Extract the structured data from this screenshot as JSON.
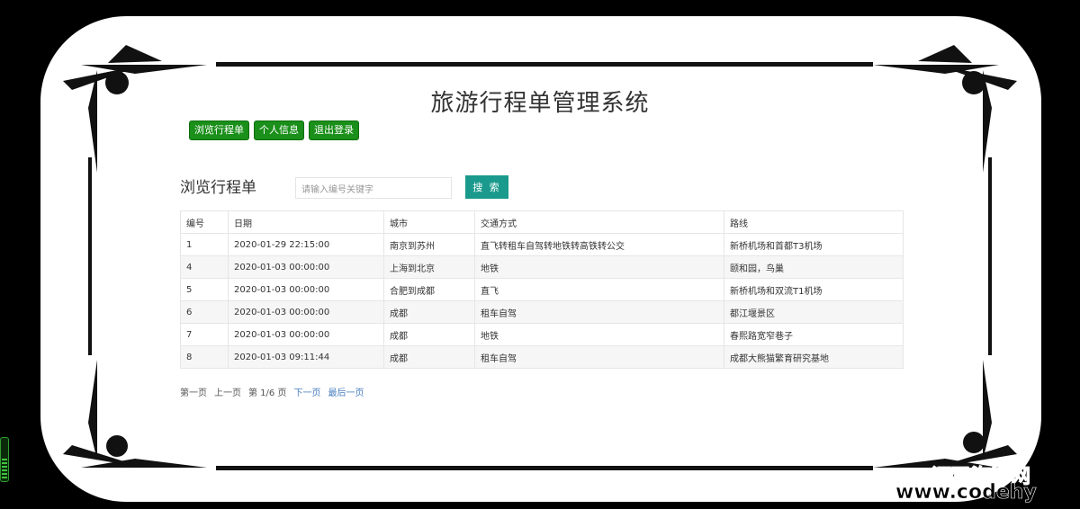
{
  "app": {
    "title": "旅游行程单管理系统"
  },
  "nav": {
    "items": [
      "浏览行程单",
      "个人信息",
      "退出登录"
    ]
  },
  "section": {
    "title": "浏览行程单"
  },
  "search": {
    "placeholder": "请输入编号关键字",
    "button_label": "搜 索"
  },
  "table": {
    "columns": [
      "编号",
      "日期",
      "城市",
      "交通方式",
      "路线"
    ],
    "rows": [
      [
        "1",
        "2020-01-29 22:15:00",
        "南京到苏州",
        "直飞转租车自驾转地铁转高铁转公交",
        "新桥机场和首都T3机场"
      ],
      [
        "4",
        "2020-01-03 00:00:00",
        "上海到北京",
        "地铁",
        "颐和园，鸟巢"
      ],
      [
        "5",
        "2020-01-03 00:00:00",
        "合肥到成都",
        "直飞",
        "新桥机场和双流T1机场"
      ],
      [
        "6",
        "2020-01-03 00:00:00",
        "成都",
        "租车自驾",
        "都江堰景区"
      ],
      [
        "7",
        "2020-01-03 00:00:00",
        "成都",
        "地铁",
        "春熙路宽窄巷子"
      ],
      [
        "8",
        "2020-01-03 09:11:44",
        "成都",
        "租车自驾",
        "成都大熊猫繁育研究基地"
      ]
    ]
  },
  "pager": {
    "first": "第一页",
    "prev": "上一页",
    "status": "第 1/6 页",
    "next": "下一页",
    "last": "最后一页"
  },
  "watermark": {
    "line1": "源码海洋网",
    "line2": "www.codehy"
  },
  "colors": {
    "nav_button": "#1a8f1a",
    "search_button": "#1a9a8c",
    "link": "#4a7fc1"
  }
}
